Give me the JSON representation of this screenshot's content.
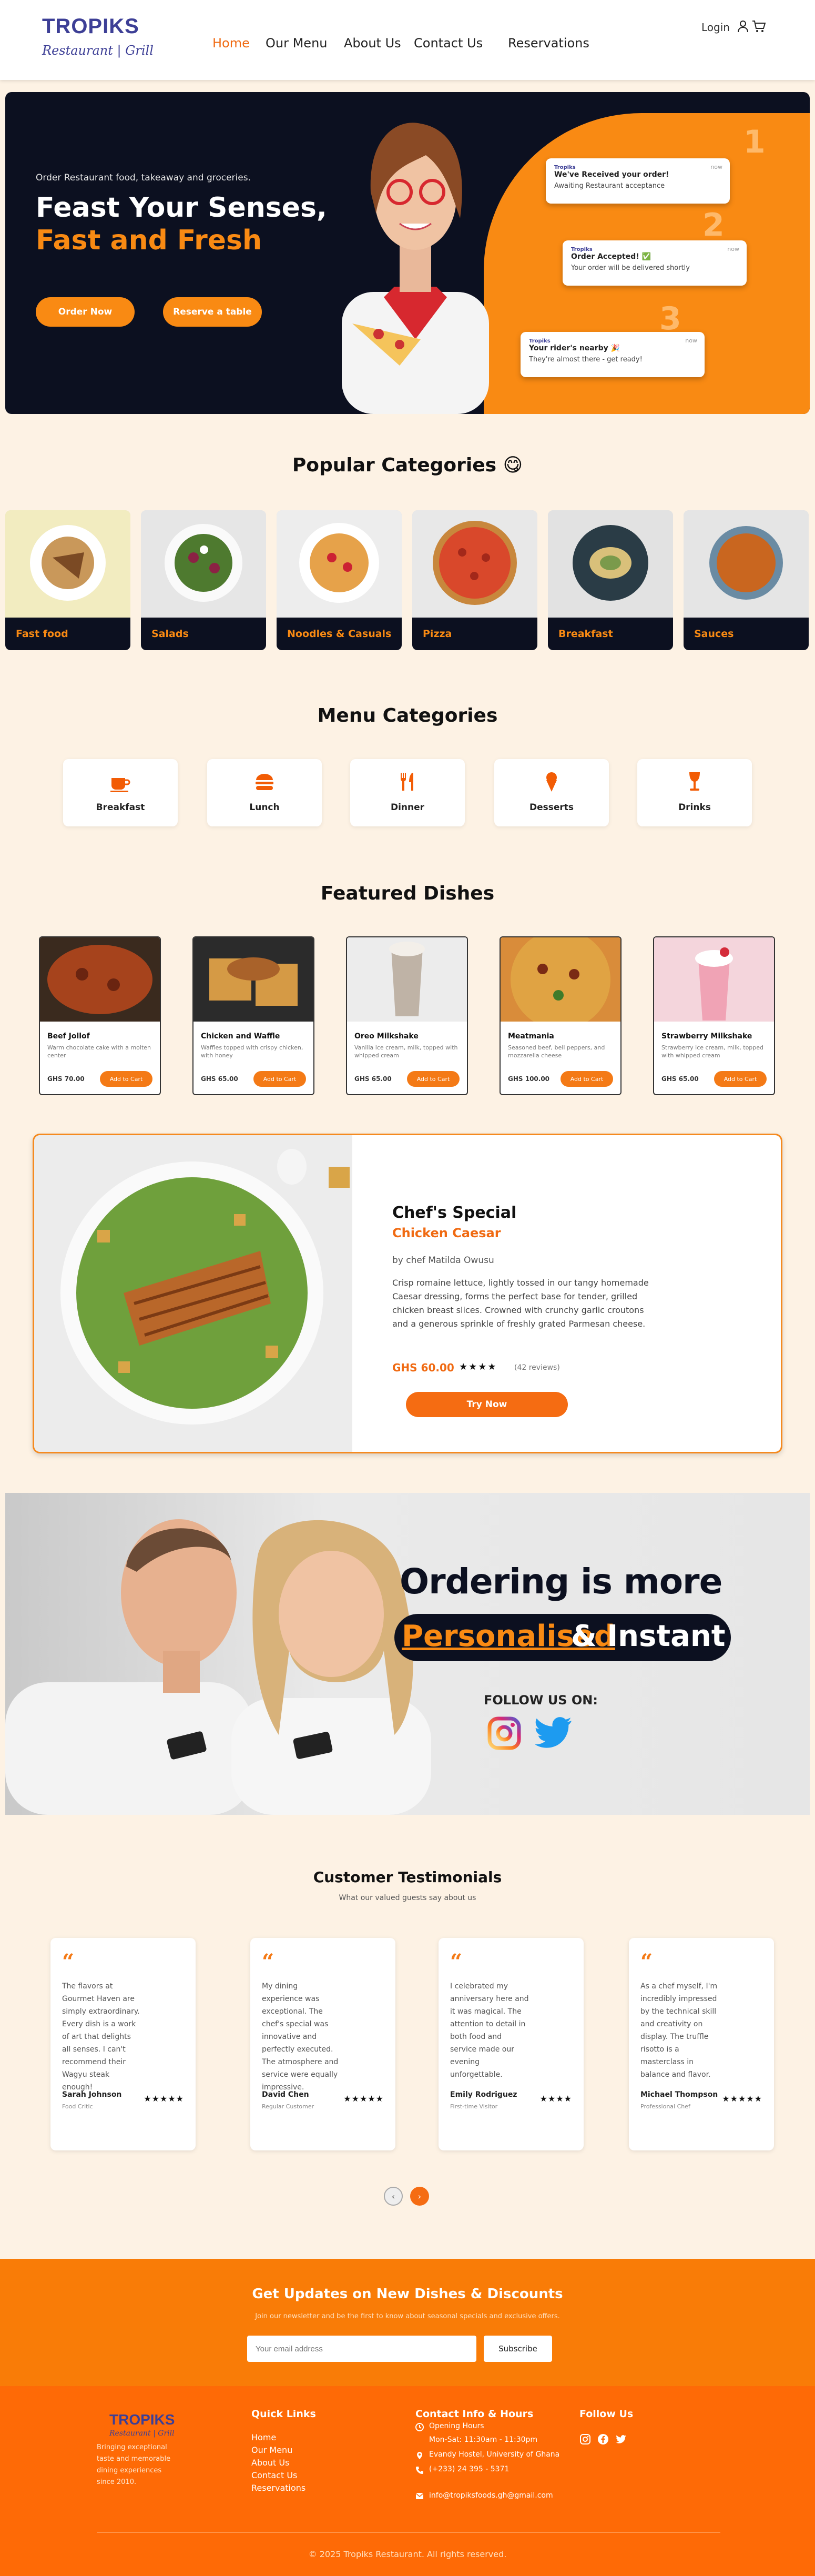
{
  "brand": {
    "name": "TROPIKS",
    "sub": "Restaurant | Grill",
    "accent": "#f98a13",
    "navy": "#0c1020"
  },
  "nav": {
    "items": [
      "Home",
      "Our Menu",
      "About Us",
      "Contact Us",
      "Reservations"
    ],
    "active": "Home",
    "login": "Login",
    "icons": [
      "user-icon",
      "cart-icon"
    ]
  },
  "hero": {
    "tagline": "Order Restaurant food, takeaway and groceries.",
    "title_1": "Feast Your Senses,",
    "title_2": "Fast and Fresh",
    "btn_order": "Order Now",
    "btn_reserve": "Reserve a table",
    "steps": [
      "1",
      "2",
      "3"
    ],
    "notifications": [
      {
        "brand": "Tropiks",
        "title": "We've Received your order!",
        "sub": "Awaiting Restaurant acceptance",
        "time": "now"
      },
      {
        "brand": "Tropiks",
        "title": "Order Accepted! ✅",
        "sub": "Your order will be delivered shortly",
        "time": "now"
      },
      {
        "brand": "Tropiks",
        "title": "Your rider's nearby 🎉",
        "sub": "They're almost there - get ready!",
        "time": "now"
      }
    ]
  },
  "popular": {
    "title": "Popular Categories 😋",
    "items": [
      "Fast food",
      "Salads",
      "Noodles & Casuals",
      "Pizza",
      "Breakfast",
      "Sauces"
    ]
  },
  "menu_categories": {
    "title": "Menu Categories",
    "items": [
      {
        "label": "Breakfast",
        "icon": "coffee-cup-icon"
      },
      {
        "label": "Lunch",
        "icon": "burger-icon"
      },
      {
        "label": "Dinner",
        "icon": "fork-knife-icon"
      },
      {
        "label": "Desserts",
        "icon": "ice-cream-icon"
      },
      {
        "label": "Drinks",
        "icon": "wine-glass-icon"
      }
    ]
  },
  "featured": {
    "title": "Featured Dishes",
    "add_label": "Add to Cart",
    "items": [
      {
        "name": "Beef Jollof",
        "desc": "Warm chocolate cake with a molten center",
        "price": "GHS 70.00"
      },
      {
        "name": "Chicken and Waffle",
        "desc": "Waffles topped with crispy chicken, with honey",
        "price": "GHS 65.00"
      },
      {
        "name": "Oreo Milkshake",
        "desc": "Vanilla ice cream, milk, topped with whipped cream",
        "price": "GHS 65.00"
      },
      {
        "name": "Meatmania",
        "desc": "Seasoned beef, bell peppers, and mozzarella cheese",
        "price": "GHS 100.00"
      },
      {
        "name": "Strawberry Milkshake",
        "desc": "Strawberry ice cream, milk, topped with whipped cream",
        "price": "GHS 65.00"
      }
    ]
  },
  "chef": {
    "title": "Chef's Special",
    "dish": "Chicken Caesar",
    "by": "by chef Matilda Owusu",
    "desc": "Crisp romaine lettuce, lightly tossed in our tangy homemade Caesar dressing, forms the perfect base for tender, grilled chicken breast slices. Crowned with crunchy garlic croutons and a generous sprinkle of freshly grated Parmesan cheese.",
    "price": "GHS 60.00",
    "stars": "★★★★",
    "rating": 4,
    "reviews": "(42 reviews)",
    "btn": "Try Now"
  },
  "ordering": {
    "line1": "Ordering is more",
    "line2a": "Personalised",
    "line2b": "& Instant",
    "follow": "FOLLOW US ON:",
    "icons": [
      "instagram-icon",
      "twitter-icon"
    ]
  },
  "testimonials": {
    "title": "Customer Testimonials",
    "sub": "What our valued guests say about us",
    "items": [
      {
        "text": "The flavors at Gourmet Haven are simply extraordinary. Every dish is a work of art that delights all senses. I can't recommend their Wagyu steak enough!",
        "name": "Sarah  Johnson",
        "role": "Food Critic",
        "stars": "★★★★★",
        "rating": 5
      },
      {
        "text": "My dining experience was exceptional. The chef's special was innovative and perfectly executed. The atmosphere and service were equally impressive.",
        "name": "David  Chen",
        "role": "Regular Customer",
        "stars": "★★★★★",
        "rating": 5
      },
      {
        "text": "I celebrated my anniversary here and it was magical. The attention to detail in both food and service made our evening unforgettable.",
        "name": "Emily  Rodriguez",
        "role": "First-time Visitor",
        "stars": "★★★★",
        "rating": 4
      },
      {
        "text": "As a chef myself, I'm incredibly impressed by the technical skill and creativity on display. The truffle risotto is a masterclass in balance and flavor.",
        "name": "Michael  Thompson",
        "role": "Professional Chef",
        "stars": "★★★★★",
        "rating": 5
      }
    ],
    "pages": [
      "‹",
      "›"
    ]
  },
  "newsletter": {
    "title": "Get Updates on New Dishes & Discounts",
    "sub": "Join our newsletter and be the first to know about seasonal specials and exclusive offers.",
    "placeholder": "Your email address",
    "btn": "Subscribe"
  },
  "footer": {
    "desc": "Bringing exceptional taste and memorable dining experiences since 2010.",
    "quick_title": "Quick Links",
    "quick": [
      "Home",
      "Our Menu",
      "About Us",
      "Contact Us",
      "Reservations"
    ],
    "contact_title": "Contact Info & Hours",
    "hours_label": "Opening Hours",
    "hours": "Mon-Sat: 11:30am - 11:30pm",
    "address": "Evandy Hostel, University of Ghana",
    "phone": "(+233) 24 395 - 5371",
    "email": "info@tropiksfoods.gh@gmail.com",
    "follow_title": "Follow Us",
    "social": [
      "instagram-icon",
      "facebook-icon",
      "twitter-icon"
    ],
    "copyright": "© 2025 Tropiks Restaurant. All rights reserved."
  }
}
